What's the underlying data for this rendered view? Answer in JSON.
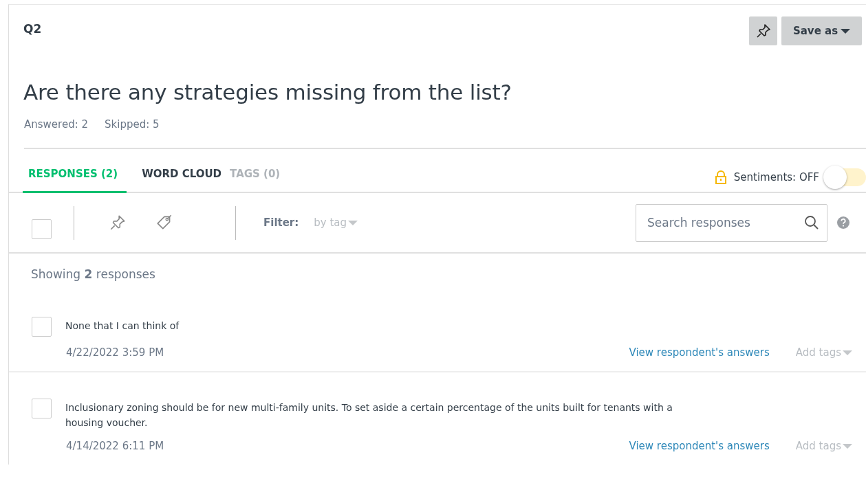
{
  "question": {
    "number": "Q2",
    "title": "Are there any strategies missing from the list?",
    "answered": "Answered: 2",
    "skipped": "Skipped: 5"
  },
  "save_button": "Save as",
  "tabs": [
    {
      "label": "RESPONSES (2)",
      "selected": true,
      "disabled": false
    },
    {
      "label": "WORD CLOUD",
      "selected": false,
      "disabled": false
    },
    {
      "label": "TAGS (0)",
      "selected": false,
      "disabled": true
    }
  ],
  "sentiments": {
    "label": "Sentiments: OFF",
    "on": false
  },
  "toolbar": {
    "select_all_checked": false,
    "filter_label": "Filter:",
    "filter_value": "by tag"
  },
  "search": {
    "placeholder": "Search responses"
  },
  "showing": "Showing **2** responses",
  "responses": [
    {
      "text": "None that I can think of",
      "date": "4/22/2022 3:59 PM",
      "checked": false,
      "link": "View respondent's answers",
      "tags": "Add tags"
    },
    {
      "text": "Inclusionary zoning should be for new multi-family units. To set aside a certain percentage of the units built for tenants with a housing voucher.",
      "date": "4/14/2022 6:11 PM",
      "checked": false,
      "link": "View respondent's answers",
      "tags": "Add tags"
    }
  ]
}
